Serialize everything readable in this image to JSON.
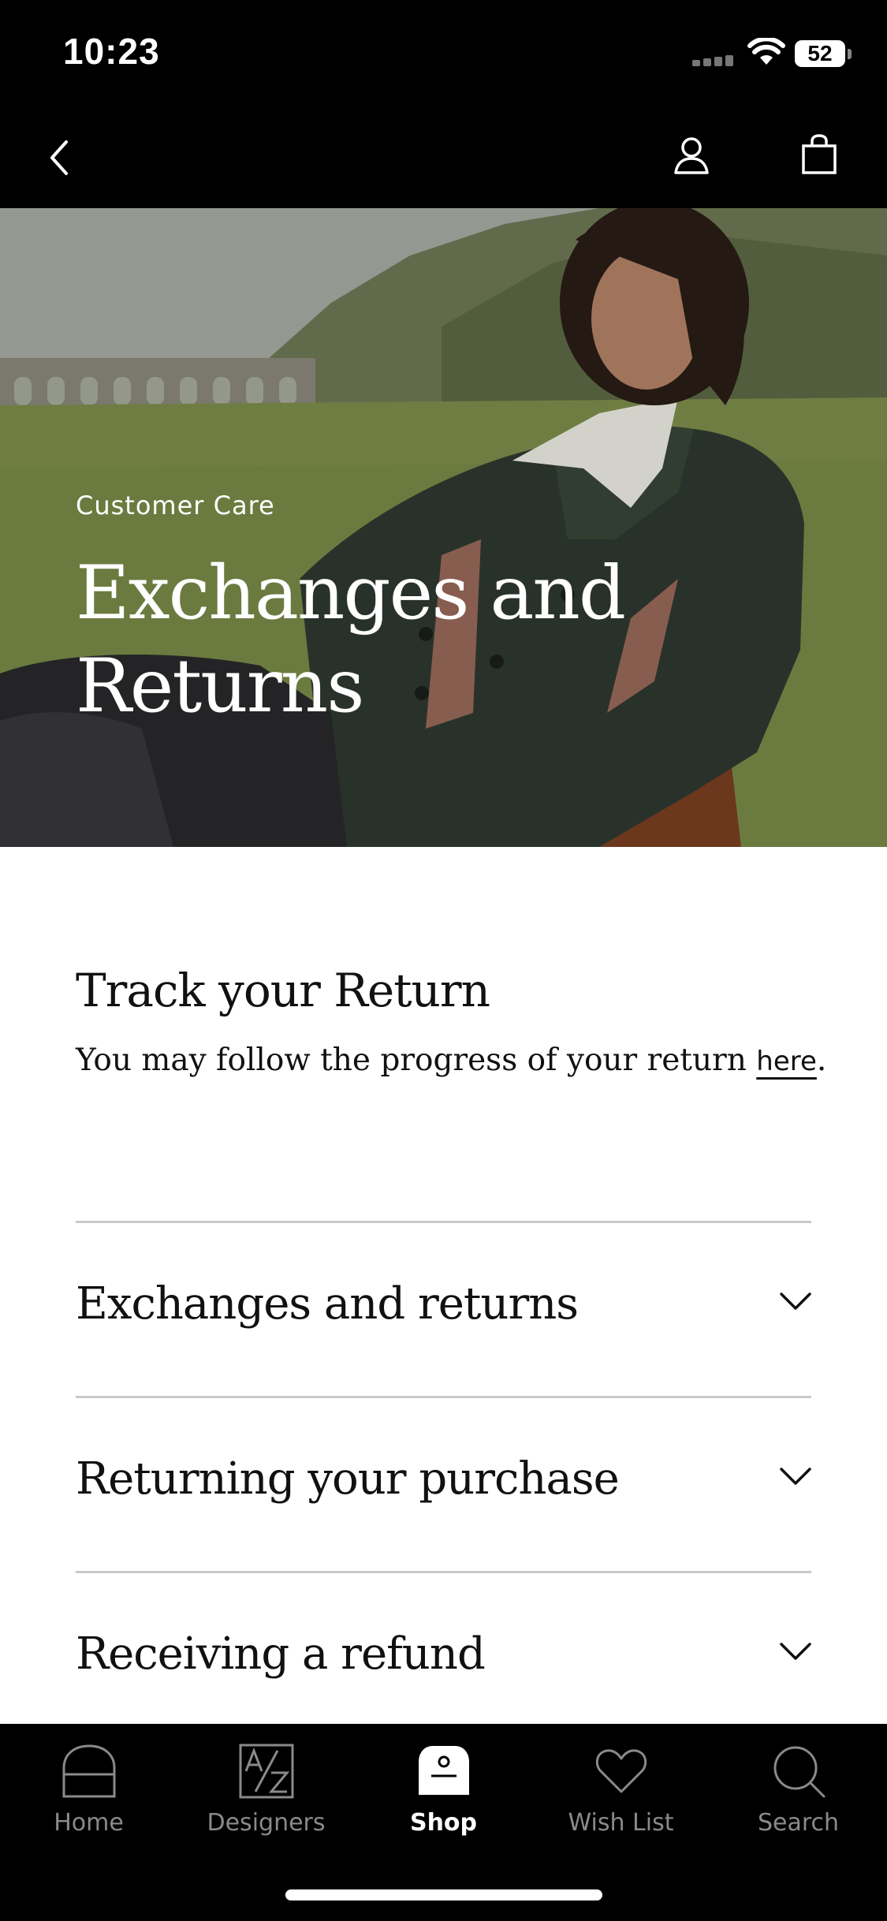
{
  "status_bar": {
    "time": "10:23",
    "battery": "52"
  },
  "header": {
    "back_icon": "chevron-left-icon",
    "account_icon": "person-icon",
    "bag_icon": "shopping-bag-icon"
  },
  "hero": {
    "eyebrow": "Customer Care",
    "title": "Exchanges and Returns"
  },
  "track": {
    "title": "Track your Return",
    "text": "You may follow the progress of your return ",
    "link": "here",
    "after": "."
  },
  "accordion": [
    {
      "label": "Exchanges and returns",
      "icon": "chevron-down-icon"
    },
    {
      "label": "Returning your purchase",
      "icon": "chevron-down-icon"
    },
    {
      "label": "Receiving a refund",
      "icon": "chevron-down-icon"
    }
  ],
  "tabs": [
    {
      "label": "Home",
      "icon": "home-icon",
      "active": false
    },
    {
      "label": "Designers",
      "icon": "designers-az-icon",
      "active": false
    },
    {
      "label": "Shop",
      "icon": "shop-bag-icon",
      "active": true
    },
    {
      "label": "Wish List",
      "icon": "heart-icon",
      "active": false
    },
    {
      "label": "Search",
      "icon": "search-icon",
      "active": false
    }
  ],
  "colors": {
    "background": "#000000",
    "content_background": "#ffffff",
    "divider": "#c9c9c9",
    "tab_inactive": "#8a8a8a",
    "tab_active": "#ffffff"
  }
}
